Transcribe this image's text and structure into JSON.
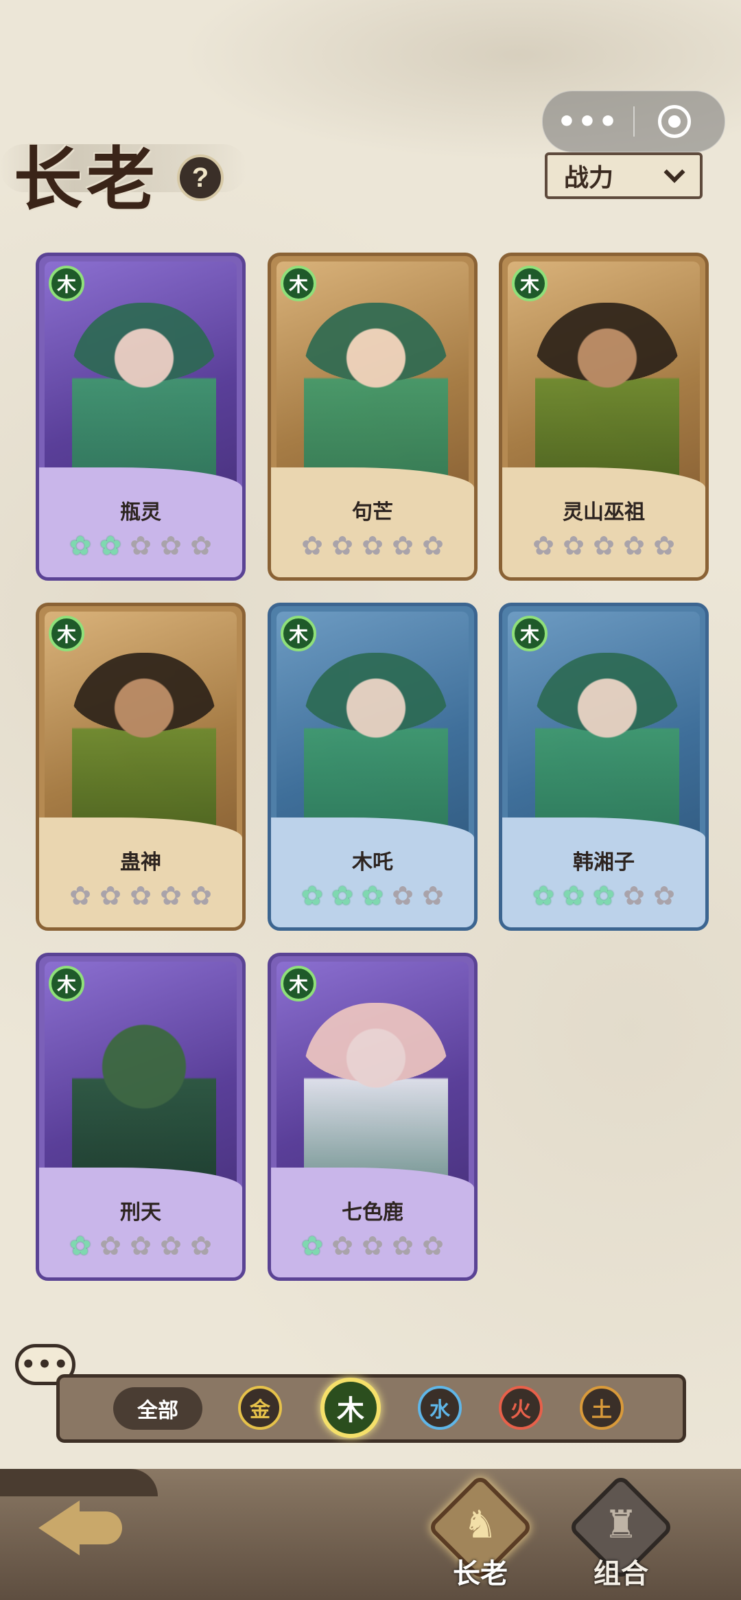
{
  "header": {
    "title": "长老",
    "help_icon": "?"
  },
  "capsule": {
    "more": "•••",
    "close": "target"
  },
  "sort": {
    "selected": "战力"
  },
  "cards": [
    {
      "name": "瓶灵",
      "element": "木",
      "frame": "purple",
      "stars_lit": 1.5
    },
    {
      "name": "句芒",
      "element": "木",
      "frame": "gold",
      "stars_lit": 0
    },
    {
      "name": "灵山巫祖",
      "element": "木",
      "frame": "gold",
      "stars_lit": 0
    },
    {
      "name": "蛊神",
      "element": "木",
      "frame": "gold",
      "stars_lit": 0
    },
    {
      "name": "木吒",
      "element": "木",
      "frame": "blue",
      "stars_lit": 2.5
    },
    {
      "name": "韩湘子",
      "element": "木",
      "frame": "blue",
      "stars_lit": 2.5
    },
    {
      "name": "刑天",
      "element": "木",
      "frame": "purple",
      "stars_lit": 1
    },
    {
      "name": "七色鹿",
      "element": "木",
      "frame": "purple",
      "stars_lit": 1
    }
  ],
  "filter": {
    "all_label": "全部",
    "elements": [
      {
        "label": "金",
        "color": "#e6c24a"
      },
      {
        "label": "木",
        "color": "#7fd86a",
        "active": true
      },
      {
        "label": "水",
        "color": "#5fb6e8"
      },
      {
        "label": "火",
        "color": "#e8604a"
      },
      {
        "label": "土",
        "color": "#d99a3a"
      }
    ]
  },
  "nav": {
    "elder_label": "长老",
    "group_label": "组合"
  }
}
